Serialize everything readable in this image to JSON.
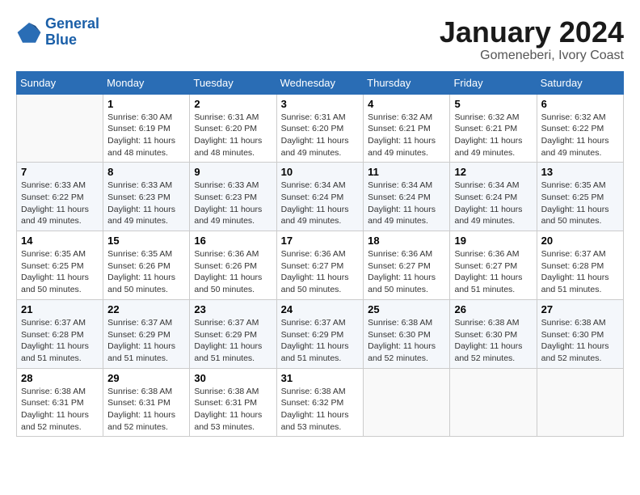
{
  "header": {
    "logo_line1": "General",
    "logo_line2": "Blue",
    "title": "January 2024",
    "subtitle": "Gomeneberi, Ivory Coast"
  },
  "days_of_week": [
    "Sunday",
    "Monday",
    "Tuesday",
    "Wednesday",
    "Thursday",
    "Friday",
    "Saturday"
  ],
  "weeks": [
    [
      {
        "num": "",
        "info": ""
      },
      {
        "num": "1",
        "info": "Sunrise: 6:30 AM\nSunset: 6:19 PM\nDaylight: 11 hours\nand 48 minutes."
      },
      {
        "num": "2",
        "info": "Sunrise: 6:31 AM\nSunset: 6:20 PM\nDaylight: 11 hours\nand 48 minutes."
      },
      {
        "num": "3",
        "info": "Sunrise: 6:31 AM\nSunset: 6:20 PM\nDaylight: 11 hours\nand 49 minutes."
      },
      {
        "num": "4",
        "info": "Sunrise: 6:32 AM\nSunset: 6:21 PM\nDaylight: 11 hours\nand 49 minutes."
      },
      {
        "num": "5",
        "info": "Sunrise: 6:32 AM\nSunset: 6:21 PM\nDaylight: 11 hours\nand 49 minutes."
      },
      {
        "num": "6",
        "info": "Sunrise: 6:32 AM\nSunset: 6:22 PM\nDaylight: 11 hours\nand 49 minutes."
      }
    ],
    [
      {
        "num": "7",
        "info": "Sunrise: 6:33 AM\nSunset: 6:22 PM\nDaylight: 11 hours\nand 49 minutes."
      },
      {
        "num": "8",
        "info": "Sunrise: 6:33 AM\nSunset: 6:23 PM\nDaylight: 11 hours\nand 49 minutes."
      },
      {
        "num": "9",
        "info": "Sunrise: 6:33 AM\nSunset: 6:23 PM\nDaylight: 11 hours\nand 49 minutes."
      },
      {
        "num": "10",
        "info": "Sunrise: 6:34 AM\nSunset: 6:24 PM\nDaylight: 11 hours\nand 49 minutes."
      },
      {
        "num": "11",
        "info": "Sunrise: 6:34 AM\nSunset: 6:24 PM\nDaylight: 11 hours\nand 49 minutes."
      },
      {
        "num": "12",
        "info": "Sunrise: 6:34 AM\nSunset: 6:24 PM\nDaylight: 11 hours\nand 49 minutes."
      },
      {
        "num": "13",
        "info": "Sunrise: 6:35 AM\nSunset: 6:25 PM\nDaylight: 11 hours\nand 50 minutes."
      }
    ],
    [
      {
        "num": "14",
        "info": "Sunrise: 6:35 AM\nSunset: 6:25 PM\nDaylight: 11 hours\nand 50 minutes."
      },
      {
        "num": "15",
        "info": "Sunrise: 6:35 AM\nSunset: 6:26 PM\nDaylight: 11 hours\nand 50 minutes."
      },
      {
        "num": "16",
        "info": "Sunrise: 6:36 AM\nSunset: 6:26 PM\nDaylight: 11 hours\nand 50 minutes."
      },
      {
        "num": "17",
        "info": "Sunrise: 6:36 AM\nSunset: 6:27 PM\nDaylight: 11 hours\nand 50 minutes."
      },
      {
        "num": "18",
        "info": "Sunrise: 6:36 AM\nSunset: 6:27 PM\nDaylight: 11 hours\nand 50 minutes."
      },
      {
        "num": "19",
        "info": "Sunrise: 6:36 AM\nSunset: 6:27 PM\nDaylight: 11 hours\nand 51 minutes."
      },
      {
        "num": "20",
        "info": "Sunrise: 6:37 AM\nSunset: 6:28 PM\nDaylight: 11 hours\nand 51 minutes."
      }
    ],
    [
      {
        "num": "21",
        "info": "Sunrise: 6:37 AM\nSunset: 6:28 PM\nDaylight: 11 hours\nand 51 minutes."
      },
      {
        "num": "22",
        "info": "Sunrise: 6:37 AM\nSunset: 6:29 PM\nDaylight: 11 hours\nand 51 minutes."
      },
      {
        "num": "23",
        "info": "Sunrise: 6:37 AM\nSunset: 6:29 PM\nDaylight: 11 hours\nand 51 minutes."
      },
      {
        "num": "24",
        "info": "Sunrise: 6:37 AM\nSunset: 6:29 PM\nDaylight: 11 hours\nand 51 minutes."
      },
      {
        "num": "25",
        "info": "Sunrise: 6:38 AM\nSunset: 6:30 PM\nDaylight: 11 hours\nand 52 minutes."
      },
      {
        "num": "26",
        "info": "Sunrise: 6:38 AM\nSunset: 6:30 PM\nDaylight: 11 hours\nand 52 minutes."
      },
      {
        "num": "27",
        "info": "Sunrise: 6:38 AM\nSunset: 6:30 PM\nDaylight: 11 hours\nand 52 minutes."
      }
    ],
    [
      {
        "num": "28",
        "info": "Sunrise: 6:38 AM\nSunset: 6:31 PM\nDaylight: 11 hours\nand 52 minutes."
      },
      {
        "num": "29",
        "info": "Sunrise: 6:38 AM\nSunset: 6:31 PM\nDaylight: 11 hours\nand 52 minutes."
      },
      {
        "num": "30",
        "info": "Sunrise: 6:38 AM\nSunset: 6:31 PM\nDaylight: 11 hours\nand 53 minutes."
      },
      {
        "num": "31",
        "info": "Sunrise: 6:38 AM\nSunset: 6:32 PM\nDaylight: 11 hours\nand 53 minutes."
      },
      {
        "num": "",
        "info": ""
      },
      {
        "num": "",
        "info": ""
      },
      {
        "num": "",
        "info": ""
      }
    ]
  ]
}
